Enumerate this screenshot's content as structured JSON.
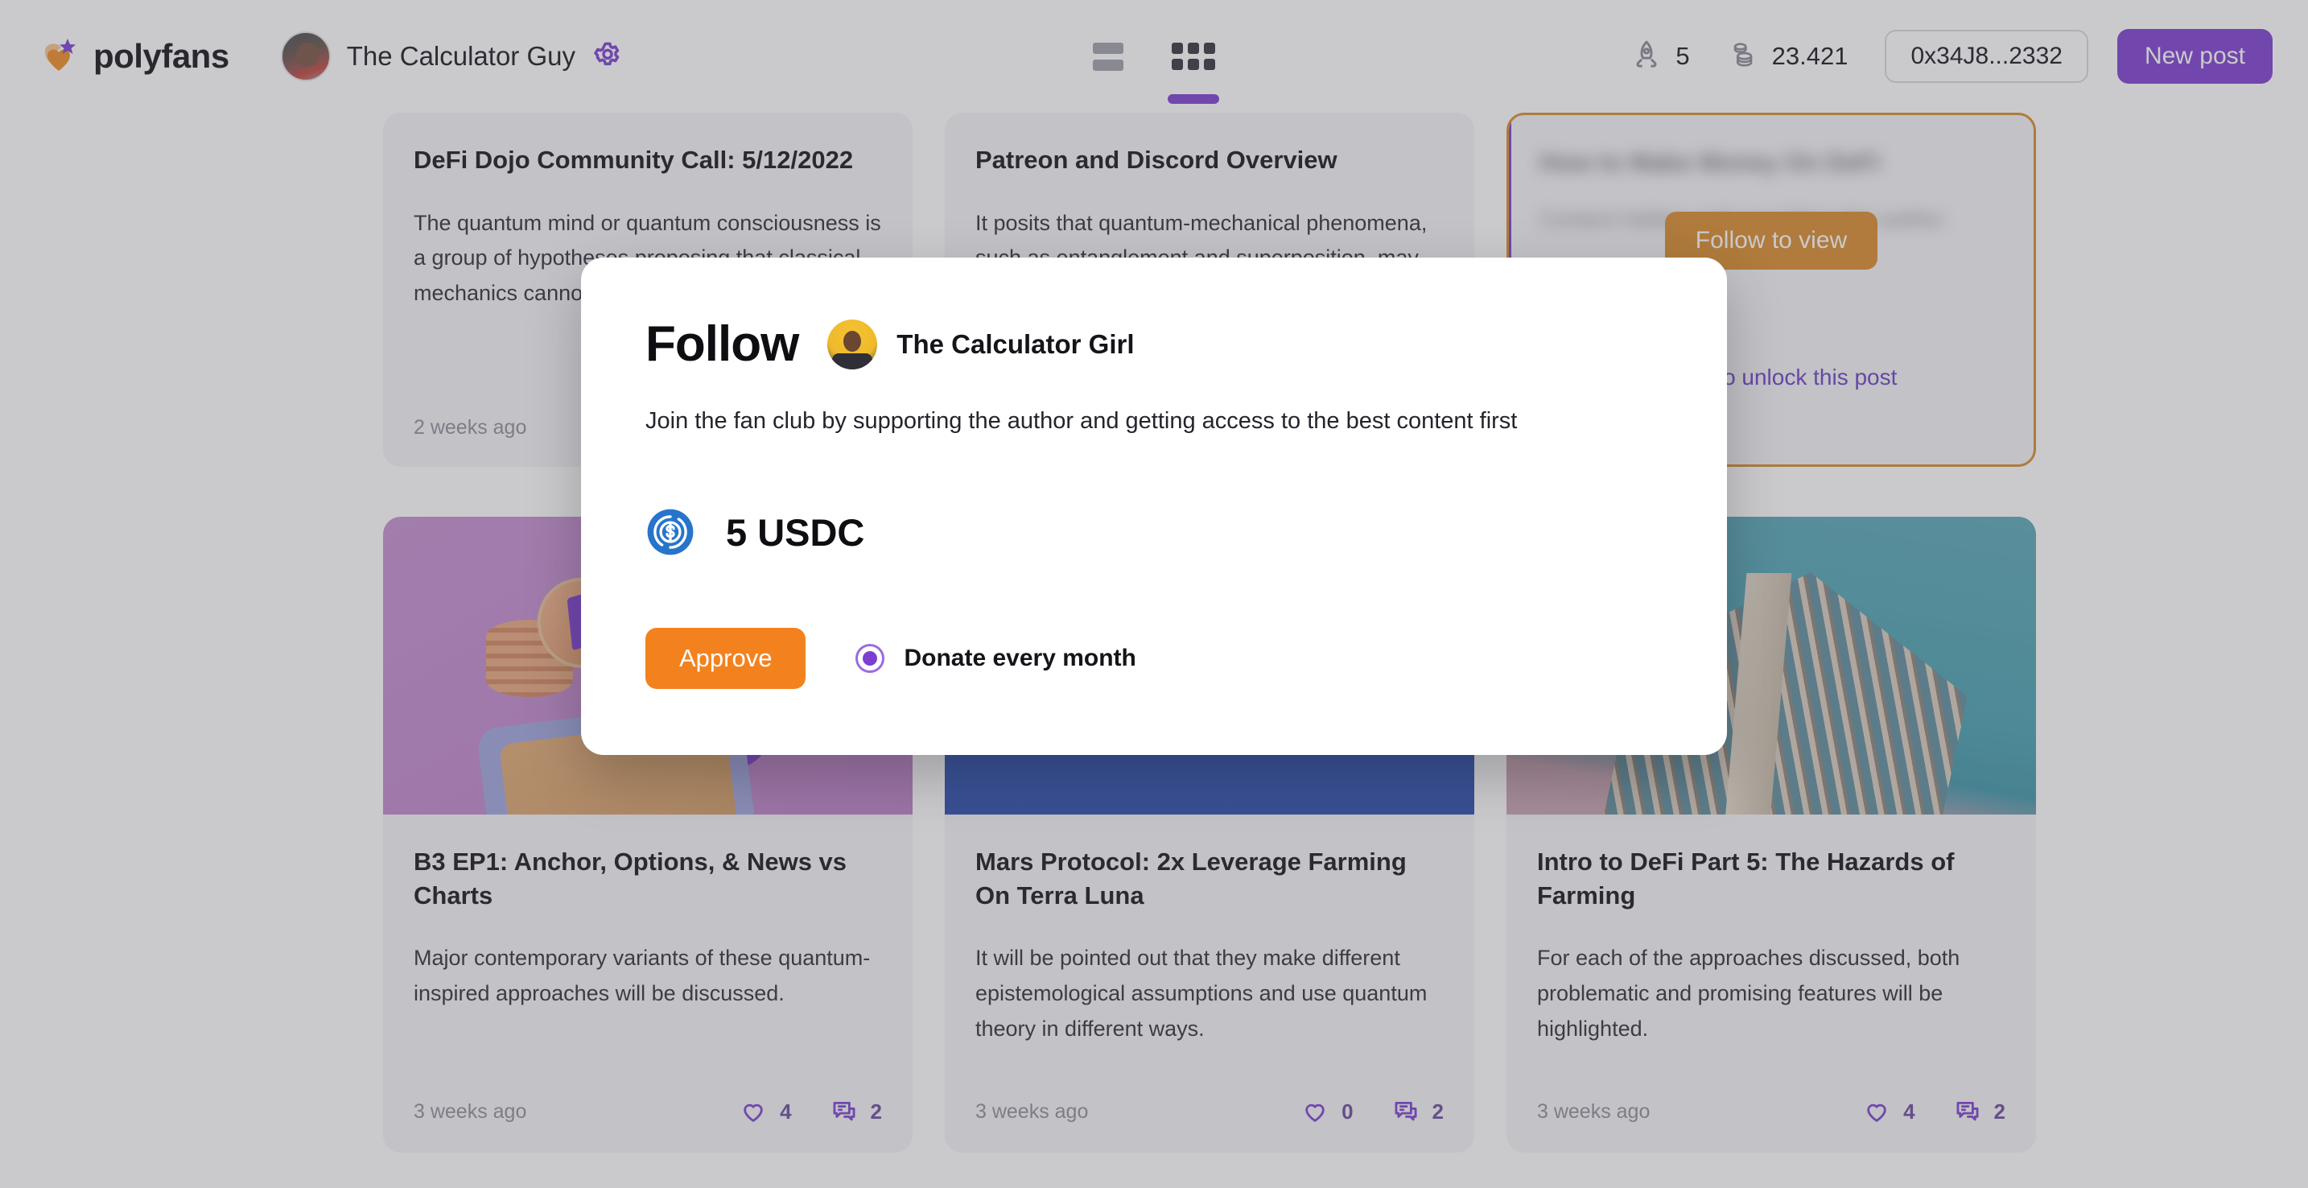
{
  "header": {
    "brand": "polyfans",
    "brand_logo_icon": "polyfans-heart-star-logo",
    "user_name": "The Calculator Guy",
    "settings_icon": "gear-icon",
    "view_list_icon": "list-view-icon",
    "view_grid_icon": "grid-view-icon",
    "active_view": "grid",
    "stats": [
      {
        "icon": "rocket-icon",
        "value": "5"
      },
      {
        "icon": "coins-stack-icon",
        "value": "23.421"
      }
    ],
    "wallet_address": "0x34J8...2332",
    "new_post_label": "New post",
    "accent_purple": "#7c3fd0"
  },
  "feed": {
    "cards": [
      {
        "title": "DeFi Dojo Community Call: 5/12/2022",
        "excerpt": "The quantum mind or quantum consciousness is a group of hypotheses proposing that classical mechanics cannot explain consciousness.",
        "time": "2 weeks ago",
        "locked": false,
        "has_image": false,
        "likes": null,
        "comments": null
      },
      {
        "title": "Patreon and Discord Overview",
        "excerpt": "It posits that quantum-mechanical phenomena, such as entanglement and superposition, may play an important part.",
        "time": "",
        "locked": false,
        "has_image": false,
        "likes": null,
        "comments": null
      },
      {
        "title": "How to Make Money On DeFi",
        "excerpt": "Content hidden until you follow this author.",
        "time": "",
        "locked": true,
        "follow_to_view_label": "Follow to view",
        "unlock_link_label": "Follow to unlock this post",
        "border_color": "#d98b2a"
      },
      {
        "title": "B3 EP1: Anchor, Options, & News vs Charts",
        "excerpt": "Major contemporary variants of these quantum-inspired approaches will be discussed.",
        "time": "3 weeks ago",
        "locked": false,
        "has_image": true,
        "image_kind": "purple-tezos-coins",
        "likes": "4",
        "comments": "2"
      },
      {
        "title": "Mars Protocol: 2x Leverage Farming On Terra Luna",
        "excerpt": "It will be pointed out that they make different epistemological assumptions and use quantum theory in different ways.",
        "time": "3 weeks ago",
        "locked": false,
        "has_image": true,
        "image_kind": "blue-gradient",
        "likes": "0",
        "comments": "2"
      },
      {
        "title": "Intro to DeFi Part 5: The Hazards of Farming",
        "excerpt": "For each of the approaches discussed, both problematic and promising features will be highlighted.",
        "time": "3 weeks ago",
        "locked": false,
        "has_image": true,
        "image_kind": "teal-skyscraper",
        "likes": "4",
        "comments": "2"
      }
    ],
    "like_icon": "heart-icon",
    "comment_icon": "comment-bubble-icon"
  },
  "modal": {
    "title": "Follow",
    "author_name": "The Calculator Girl",
    "author_avatar_icon": "author-avatar",
    "description": "Join the fan club by supporting the author and getting access to the best content first",
    "price": "5 USDC",
    "price_token_icon": "usdc-coin-icon",
    "approve_label": "Approve",
    "recurring_label": "Donate every month",
    "recurring_selected": true,
    "approve_color": "#f3821e",
    "radio_color": "#7c3fd0"
  }
}
